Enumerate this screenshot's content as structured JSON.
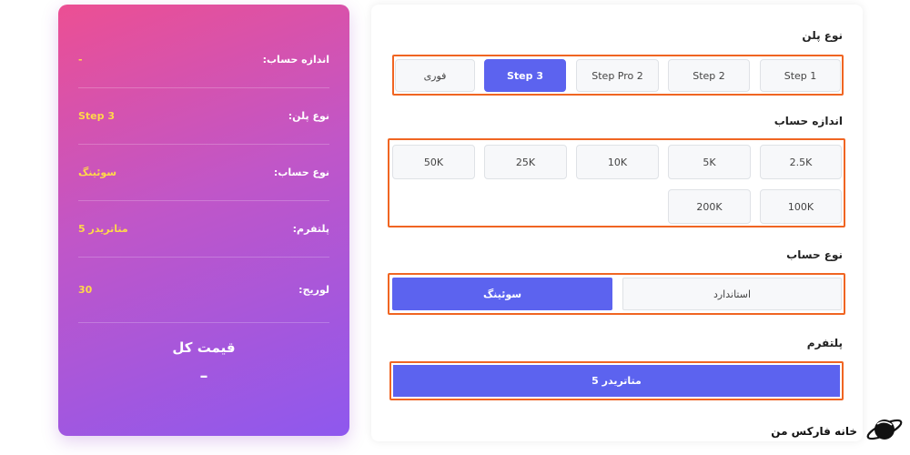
{
  "summary": {
    "rows": [
      {
        "label": "اندازه حساب:",
        "value": "-"
      },
      {
        "label": "نوع پلن:",
        "value": "Step 3"
      },
      {
        "label": "نوع حساب:",
        "value": "سوئینگ"
      },
      {
        "label": "پلتفرم:",
        "value": "متاتریدر 5"
      },
      {
        "label": "لوریج:",
        "value": "30"
      }
    ],
    "total_title": "قیمت کل",
    "total_value": "–"
  },
  "plan": {
    "title": "نوع پلن",
    "options": [
      "Step 1",
      "Step 2",
      "Step Pro 2",
      "Step 3",
      "فوری"
    ],
    "selected": "Step 3"
  },
  "size": {
    "title": "اندازه حساب",
    "options": [
      "2.5K",
      "5K",
      "10K",
      "25K",
      "50K",
      "100K",
      "200K"
    ]
  },
  "account": {
    "title": "نوع حساب",
    "options": [
      "استاندارد",
      "سوئینگ"
    ],
    "selected": "سوئینگ"
  },
  "platform": {
    "title": "پلتفرم",
    "options": [
      "متاتریدر 5"
    ],
    "selected": "متاتریدر 5"
  },
  "brand": {
    "name": "خانه فارکس من",
    "icon": "planet-icon"
  },
  "colors": {
    "accent": "#5c63ef",
    "highlight_border": "#f06522",
    "summary_value": "#ffd84a"
  }
}
